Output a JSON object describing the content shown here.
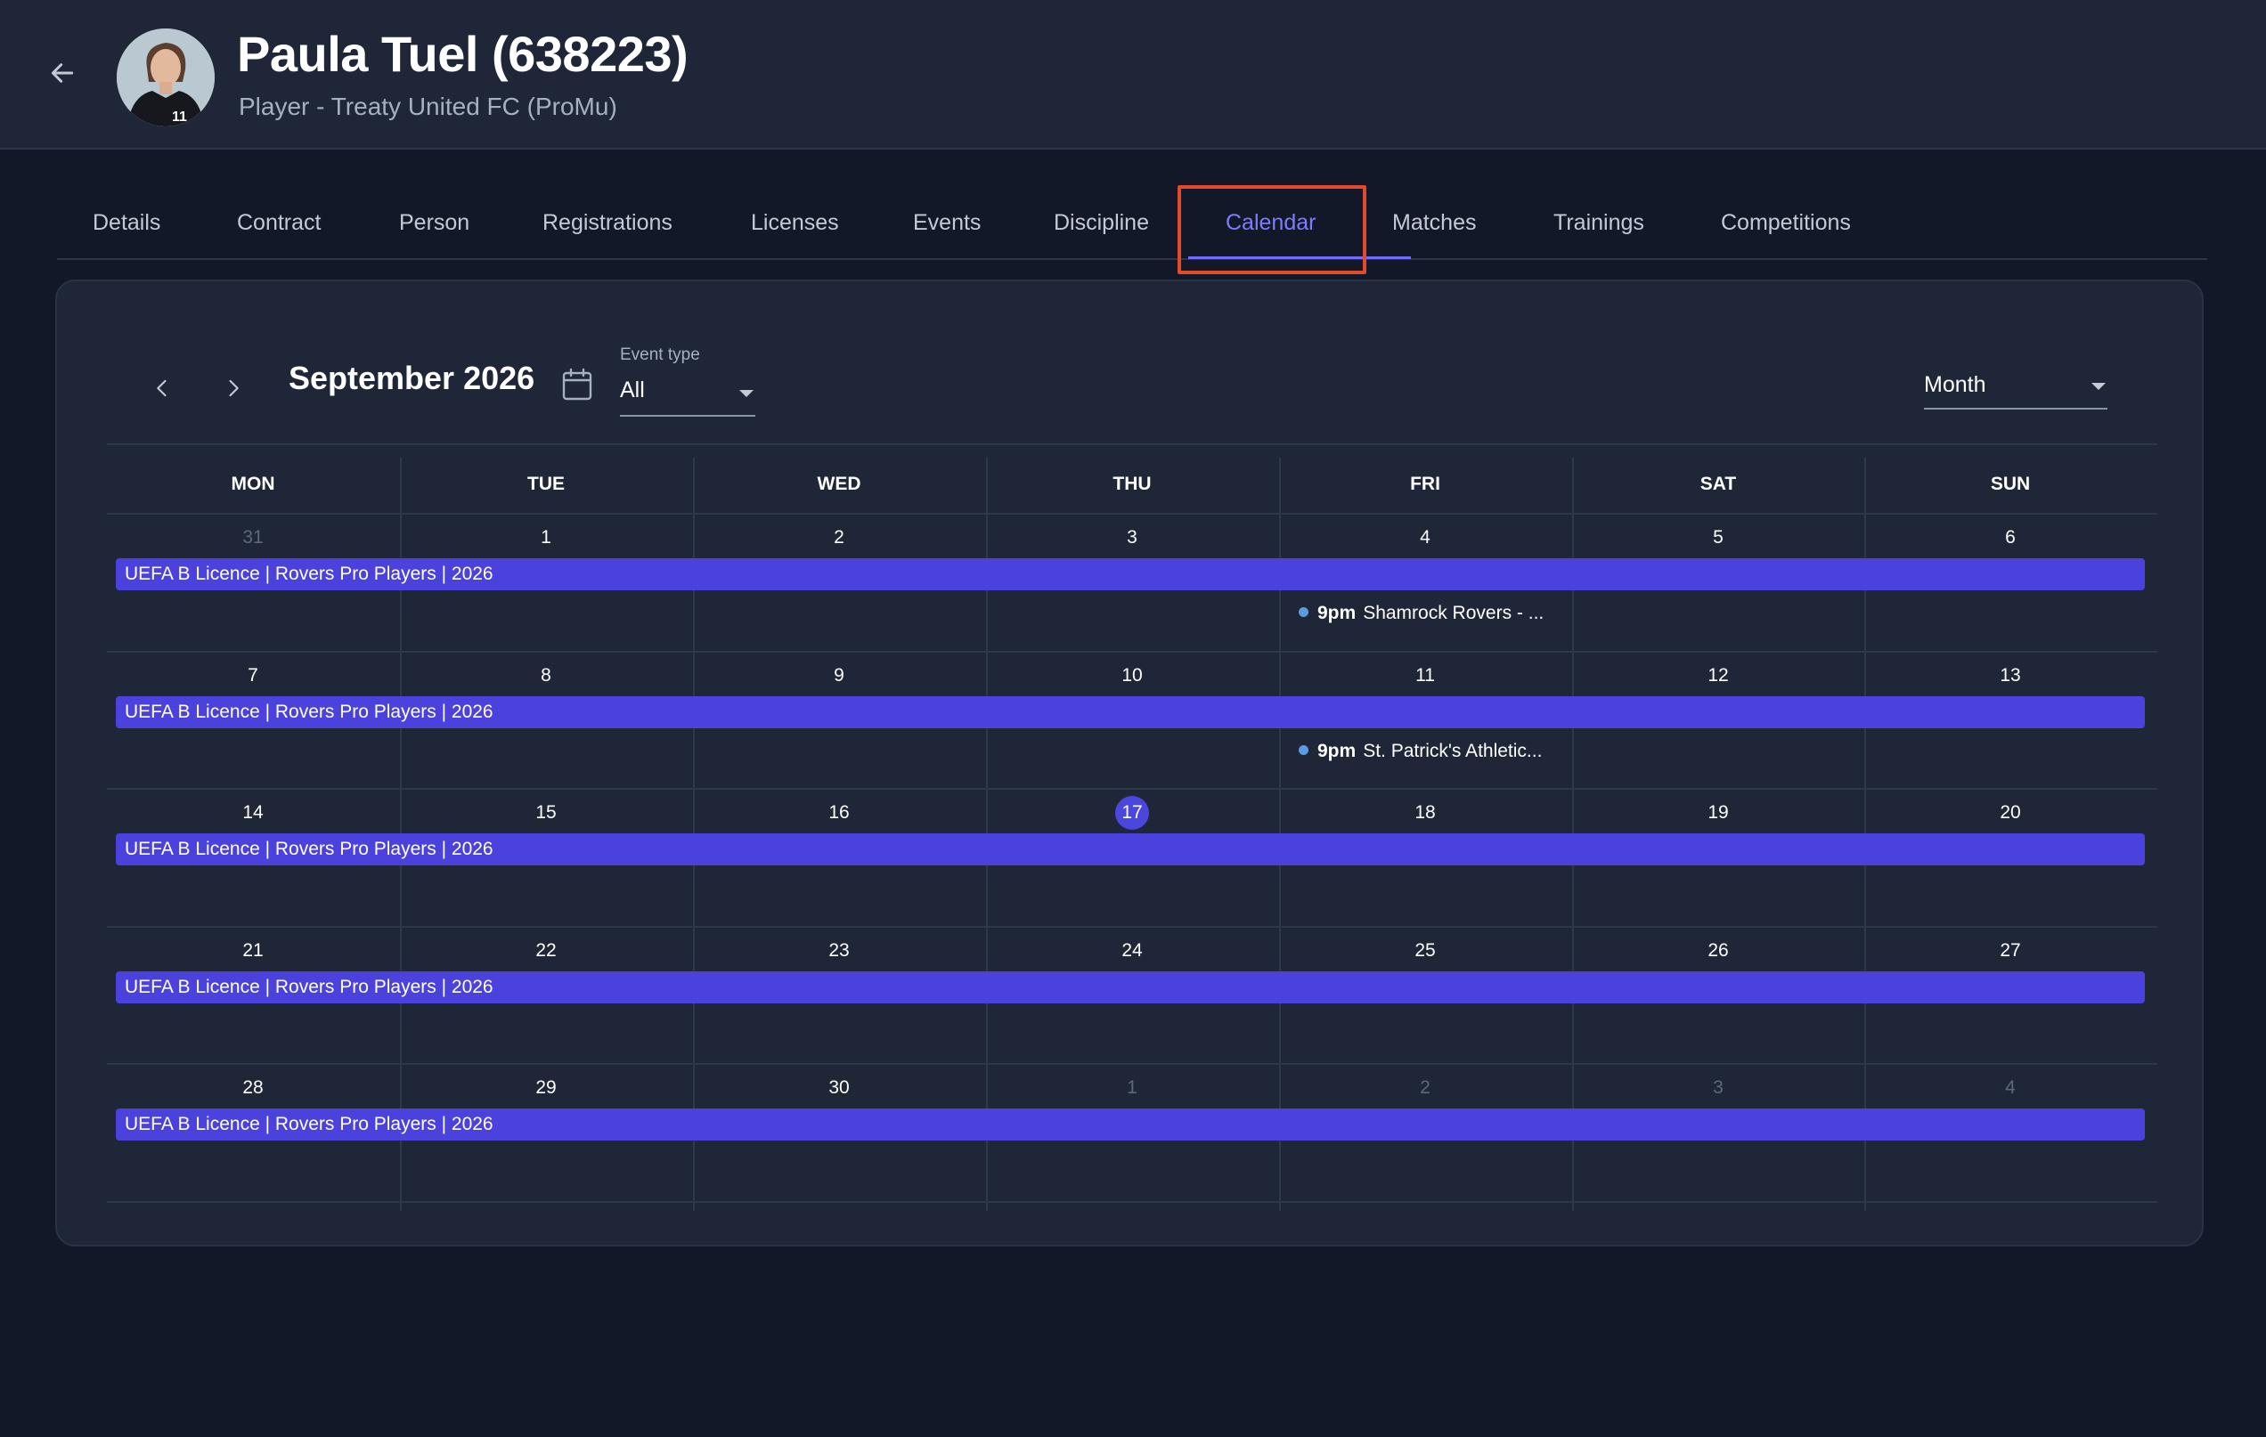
{
  "header": {
    "back_icon": "arrow-left-icon",
    "name": "Paula Tuel (638223)",
    "subtitle": "Player - Treaty United FC (ProMu)"
  },
  "tabs": [
    {
      "label": "Details"
    },
    {
      "label": "Contract"
    },
    {
      "label": "Person"
    },
    {
      "label": "Registrations"
    },
    {
      "label": "Licenses"
    },
    {
      "label": "Events"
    },
    {
      "label": "Discipline"
    },
    {
      "label": "Calendar",
      "active": true
    },
    {
      "label": "Matches"
    },
    {
      "label": "Trainings"
    },
    {
      "label": "Competitions"
    }
  ],
  "toolbar": {
    "month_title": "September 2026",
    "event_type_label": "Event type",
    "event_type_value": "All",
    "view_value": "Month"
  },
  "calendar": {
    "weekdays": [
      "MON",
      "TUE",
      "WED",
      "THU",
      "FRI",
      "SAT",
      "SUN"
    ],
    "today": "17",
    "weeks": [
      {
        "days": [
          "31",
          "1",
          "2",
          "3",
          "4",
          "5",
          "6"
        ],
        "muted": [
          true,
          false,
          false,
          false,
          false,
          false,
          false
        ],
        "bar": "UEFA B Licence | Rovers Pro Players | 2026",
        "timed": {
          "day_index": 4,
          "time": "9pm",
          "title": "Shamrock Rovers - ..."
        }
      },
      {
        "days": [
          "7",
          "8",
          "9",
          "10",
          "11",
          "12",
          "13"
        ],
        "muted": [
          false,
          false,
          false,
          false,
          false,
          false,
          false
        ],
        "bar": "UEFA B Licence | Rovers Pro Players | 2026",
        "timed": {
          "day_index": 4,
          "time": "9pm",
          "title": "St. Patrick's Athletic..."
        }
      },
      {
        "days": [
          "14",
          "15",
          "16",
          "17",
          "18",
          "19",
          "20"
        ],
        "muted": [
          false,
          false,
          false,
          false,
          false,
          false,
          false
        ],
        "bar": "UEFA B Licence | Rovers Pro Players | 2026"
      },
      {
        "days": [
          "21",
          "22",
          "23",
          "24",
          "25",
          "26",
          "27"
        ],
        "muted": [
          false,
          false,
          false,
          false,
          false,
          false,
          false
        ],
        "bar": "UEFA B Licence | Rovers Pro Players | 2026"
      },
      {
        "days": [
          "28",
          "29",
          "30",
          "1",
          "2",
          "3",
          "4"
        ],
        "muted": [
          false,
          false,
          false,
          true,
          true,
          true,
          true
        ],
        "bar": "UEFA B Licence | Rovers Pro Players | 2026"
      }
    ]
  },
  "colors": {
    "background": "#121827",
    "surface": "#1e2638",
    "accent": "#4b42de",
    "active_tab": "#7c7cff",
    "highlight": "#e24a2b",
    "event_dot": "#5b9be0"
  }
}
